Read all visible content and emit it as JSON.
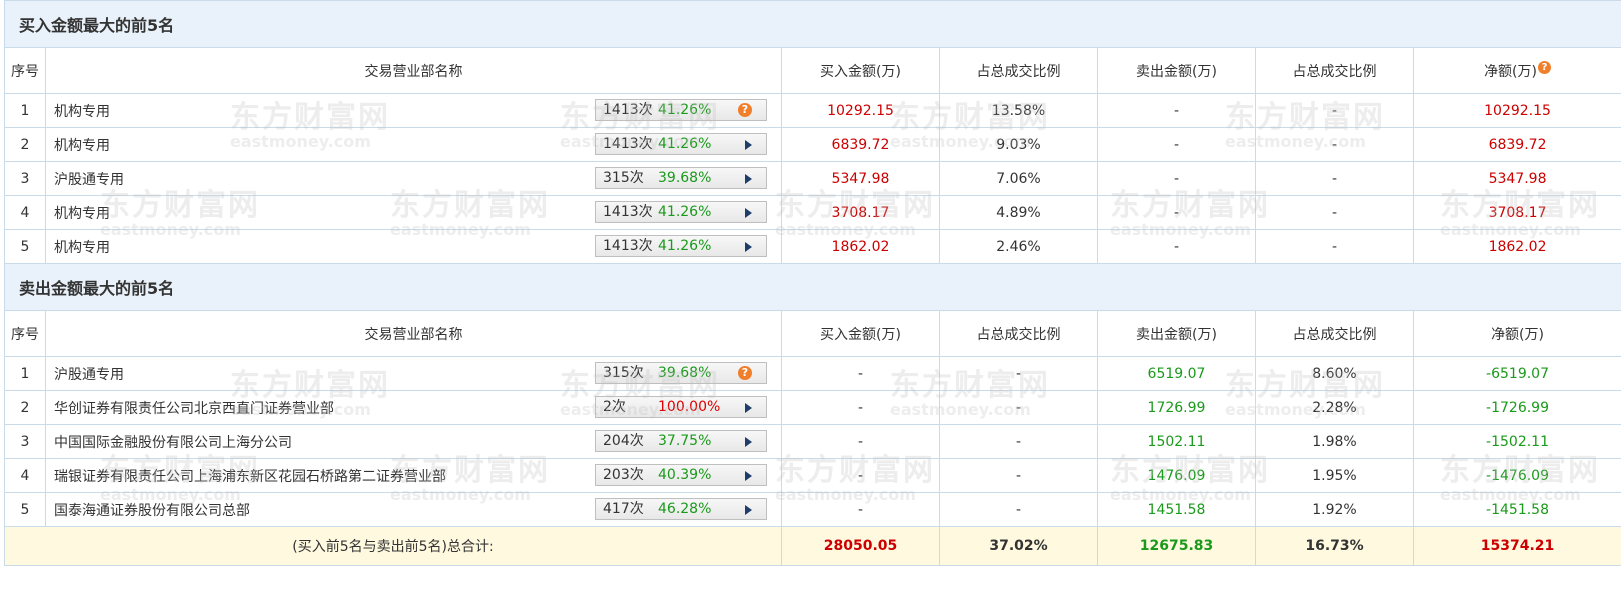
{
  "buy_section": {
    "title": "买入金额最大的前5名",
    "headers": {
      "index": "序号",
      "name": "交易营业部名称",
      "buy": "买入金额(万)",
      "buy_pct": "占总成交比例",
      "sell": "卖出金额(万)",
      "sell_pct": "占总成交比例",
      "net": "净额(万)"
    },
    "rows": [
      {
        "index": "1",
        "name": "机构专用",
        "count": "1413次",
        "win": "41.26%",
        "buy": "10292.15",
        "buy_pct": "13.58%",
        "sell": "-",
        "sell_pct": "-",
        "net": "10292.15",
        "control": "question"
      },
      {
        "index": "2",
        "name": "机构专用",
        "count": "1413次",
        "win": "41.26%",
        "buy": "6839.72",
        "buy_pct": "9.03%",
        "sell": "-",
        "sell_pct": "-",
        "net": "6839.72",
        "control": "arrow"
      },
      {
        "index": "3",
        "name": "沪股通专用",
        "count": "315次",
        "win": "39.68%",
        "buy": "5347.98",
        "buy_pct": "7.06%",
        "sell": "-",
        "sell_pct": "-",
        "net": "5347.98",
        "control": "arrow"
      },
      {
        "index": "4",
        "name": "机构专用",
        "count": "1413次",
        "win": "41.26%",
        "buy": "3708.17",
        "buy_pct": "4.89%",
        "sell": "-",
        "sell_pct": "-",
        "net": "3708.17",
        "control": "arrow"
      },
      {
        "index": "5",
        "name": "机构专用",
        "count": "1413次",
        "win": "41.26%",
        "buy": "1862.02",
        "buy_pct": "2.46%",
        "sell": "-",
        "sell_pct": "-",
        "net": "1862.02",
        "control": "arrow"
      }
    ]
  },
  "sell_section": {
    "title": "卖出金额最大的前5名",
    "headers": {
      "index": "序号",
      "name": "交易营业部名称",
      "buy": "买入金额(万)",
      "buy_pct": "占总成交比例",
      "sell": "卖出金额(万)",
      "sell_pct": "占总成交比例",
      "net": "净额(万)"
    },
    "rows": [
      {
        "index": "1",
        "name": "沪股通专用",
        "count": "315次",
        "win": "39.68%",
        "win_color": "green",
        "buy": "-",
        "buy_pct": "-",
        "sell": "6519.07",
        "sell_pct": "8.60%",
        "net": "-6519.07",
        "control": "question"
      },
      {
        "index": "2",
        "name": "华创证券有限责任公司北京西直门证券营业部",
        "count": "2次",
        "win": "100.00%",
        "win_color": "red",
        "buy": "-",
        "buy_pct": "-",
        "sell": "1726.99",
        "sell_pct": "2.28%",
        "net": "-1726.99",
        "control": "arrow"
      },
      {
        "index": "3",
        "name": "中国国际金融股份有限公司上海分公司",
        "count": "204次",
        "win": "37.75%",
        "win_color": "green",
        "buy": "-",
        "buy_pct": "-",
        "sell": "1502.11",
        "sell_pct": "1.98%",
        "net": "-1502.11",
        "control": "arrow"
      },
      {
        "index": "4",
        "name": "瑞银证券有限责任公司上海浦东新区花园石桥路第二证券营业部",
        "count": "203次",
        "win": "40.39%",
        "win_color": "green",
        "buy": "-",
        "buy_pct": "-",
        "sell": "1476.09",
        "sell_pct": "1.95%",
        "net": "-1476.09",
        "control": "arrow"
      },
      {
        "index": "5",
        "name": "国泰海通证券股份有限公司总部",
        "count": "417次",
        "win": "46.28%",
        "win_color": "green",
        "buy": "-",
        "buy_pct": "-",
        "sell": "1451.58",
        "sell_pct": "1.92%",
        "net": "-1451.58",
        "control": "arrow"
      }
    ]
  },
  "total": {
    "label": "(买入前5名与卖出前5名)总合计:",
    "buy": "28050.05",
    "buy_pct": "37.02%",
    "sell": "12675.83",
    "sell_pct": "16.73%",
    "net": "15374.21"
  },
  "watermark": {
    "cn": "东方财富网",
    "en": "eastmoney.com"
  },
  "colors": {
    "header_bg": "#e9f2fa",
    "border": "#c9dbe9",
    "total_bg": "#fff9e0",
    "red": "#c00",
    "green": "#1a9a1a",
    "icon_orange": "#f07f2b"
  }
}
